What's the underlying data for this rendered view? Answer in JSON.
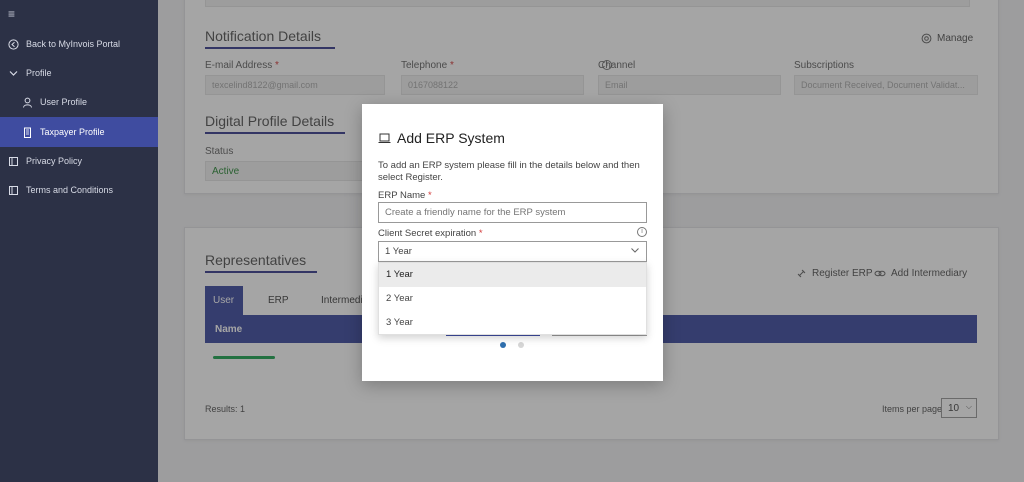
{
  "sidebar": {
    "items": [
      {
        "label": "Back to MyInvois Portal",
        "icon": "arrow-left-circle-icon"
      },
      {
        "label": "Profile",
        "icon": "chevron-down-icon"
      },
      {
        "label": "User Profile",
        "icon": "user-icon"
      },
      {
        "label": "Taxpayer Profile",
        "icon": "building-icon"
      },
      {
        "label": "Privacy Policy",
        "icon": "book-icon"
      },
      {
        "label": "Terms and Conditions",
        "icon": "book-icon"
      }
    ]
  },
  "notification": {
    "title": "Notification Details",
    "manage_label": "Manage",
    "email_label": "E-mail Address",
    "email_value": "texcelind8122@gmail.com",
    "telephone_label": "Telephone",
    "telephone_value": "0167088122",
    "channel_label": "Channel",
    "channel_value": "Email",
    "subscriptions_label": "Subscriptions",
    "subscriptions_value": "Document Received, Document Validat..."
  },
  "digital_profile": {
    "title": "Digital Profile Details",
    "status_label": "Status",
    "status_value": "Active"
  },
  "representatives": {
    "title": "Representatives",
    "register_erp": "Register ERP",
    "add_intermediary": "Add Intermediary",
    "tabs": [
      "User",
      "ERP",
      "Intermediary"
    ],
    "col_name": "Name",
    "results": "Results: 1",
    "items_per_page_label": "Items per page:",
    "items_per_page_value": "10"
  },
  "modal": {
    "title": "Add ERP System",
    "description": "To add an ERP system please fill in the details below and then select Register.",
    "erp_name_label": "ERP Name",
    "erp_name_placeholder": "Create a friendly name for the ERP system",
    "secret_label": "Client Secret expiration",
    "secret_value": "1 Year",
    "options": [
      "1 Year",
      "2 Year",
      "3 Year"
    ]
  },
  "colors": {
    "sidebar_bg": "#2c3146",
    "accent": "#3f4ca0",
    "status_active": "#2e8b3a"
  }
}
